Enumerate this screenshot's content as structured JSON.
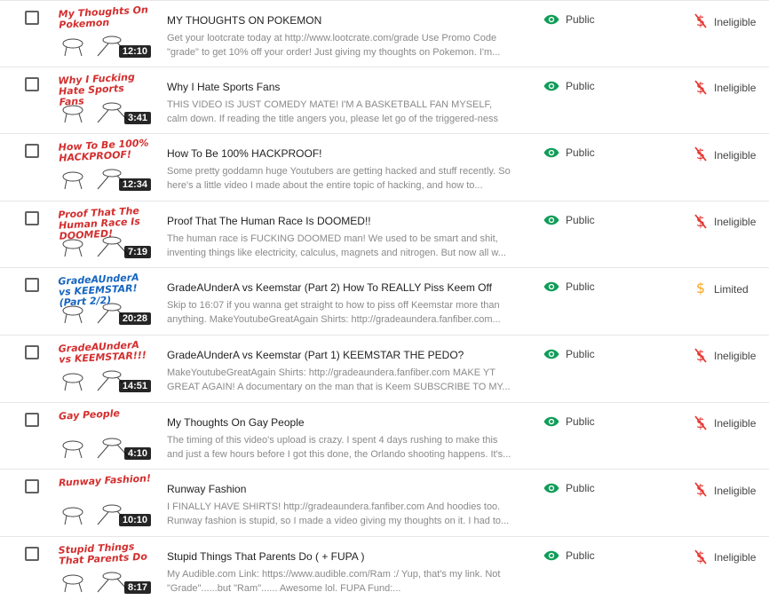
{
  "colors": {
    "public_green": "#0f9d58",
    "ineligible_red": "#e53935",
    "limited_yellow": "#f9a825",
    "title_red": "#d32f2f",
    "title_blue": "#1565c0"
  },
  "videos": [
    {
      "thumb_text": "My Thoughts On Pokemon",
      "duration": "12:10",
      "title": "MY THOUGHTS ON POKEMON",
      "description": "Get your lootcrate today at http://www.lootcrate.com/grade Use Promo Code \"grade\" to get 10% off your order! Just giving my thoughts on Pokemon. I'm...",
      "visibility": "Public",
      "visibility_icon": "eye-icon",
      "monetization": "Ineligible",
      "monetization_icon": "dollar-off-icon"
    },
    {
      "thumb_text": "Why I Fucking Hate Sports Fans",
      "duration": "3:41",
      "title": "Why I Hate Sports Fans",
      "description": "THIS VIDEO IS JUST COMEDY MATE! I'M A BASKETBALL FAN MYSELF, calm down. If reading the title angers you, please let go of the triggered-ness and...",
      "visibility": "Public",
      "visibility_icon": "eye-icon",
      "monetization": "Ineligible",
      "monetization_icon": "dollar-off-icon"
    },
    {
      "thumb_text": "How To Be 100% HACKPROOF!",
      "duration": "12:34",
      "title": "How To Be 100% HACKPROOF!",
      "description": "Some pretty goddamn huge Youtubers are getting hacked and stuff recently. So here's a little video I made about the entire topic of hacking, and how to...",
      "visibility": "Public",
      "visibility_icon": "eye-icon",
      "monetization": "Ineligible",
      "monetization_icon": "dollar-off-icon"
    },
    {
      "thumb_text": "Proof That The Human Race Is DOOMED!",
      "duration": "7:19",
      "title": "Proof That The Human Race Is DOOMED!!",
      "description": "The human race is FUCKING DOOMED man! We used to be smart and shit, inventing things like electricity, calculus, magnets and nitrogen. But now all w...",
      "visibility": "Public",
      "visibility_icon": "eye-icon",
      "monetization": "Ineligible",
      "monetization_icon": "dollar-off-icon"
    },
    {
      "thumb_text": "GradeAUnderA vs KEEMSTAR! (Part 2/2)",
      "duration": "20:28",
      "title": "GradeAUnderA vs Keemstar (Part 2) How To REALLY Piss Keem Off",
      "description": "Skip to 16:07 if you wanna get straight to how to piss off Keemstar more than anything. MakeYoutubeGreatAgain Shirts: http://gradeaundera.fanfiber.com...",
      "visibility": "Public",
      "visibility_icon": "eye-icon",
      "monetization": "Limited",
      "monetization_icon": "dollar-icon"
    },
    {
      "thumb_text": "GradeAUnderA vs KEEMSTAR!!!",
      "duration": "14:51",
      "title": "GradeAUnderA vs Keemstar (Part 1) KEEMSTAR THE PEDO?",
      "description": "MakeYoutubeGreatAgain Shirts: http://gradeaundera.fanfiber.com MAKE YT GREAT AGAIN! A documentary on the man that is Keem SUBSCRIBE TO MY...",
      "visibility": "Public",
      "visibility_icon": "eye-icon",
      "monetization": "Ineligible",
      "monetization_icon": "dollar-off-icon"
    },
    {
      "thumb_text": "Gay People",
      "duration": "4:10",
      "title": "My Thoughts On Gay People",
      "description": "The timing of this video's upload is crazy. I spent 4 days rushing to make this and just a few hours before I got this done, the Orlando shooting happens. It's...",
      "visibility": "Public",
      "visibility_icon": "eye-icon",
      "monetization": "Ineligible",
      "monetization_icon": "dollar-off-icon"
    },
    {
      "thumb_text": "Runway Fashion!",
      "duration": "10:10",
      "title": "Runway Fashion",
      "description": "I FINALLY HAVE SHIRTS! http://gradeaundera.fanfiber.com And hoodies too. Runway fashion is stupid, so I made a video giving my thoughts on it. I had to...",
      "visibility": "Public",
      "visibility_icon": "eye-icon",
      "monetization": "Ineligible",
      "monetization_icon": "dollar-off-icon"
    },
    {
      "thumb_text": "Stupid Things That Parents Do",
      "duration": "8:17",
      "title": "Stupid Things That Parents Do ( + FUPA )",
      "description": "My Audible.com Link: https://www.audible.com/Ram :/ Yup, that's my link. Not \"Grade\"......but \"Ram\"...... Awesome lol. FUPA Fund:...",
      "visibility": "Public",
      "visibility_icon": "eye-icon",
      "monetization": "Ineligible",
      "monetization_icon": "dollar-off-icon"
    }
  ]
}
